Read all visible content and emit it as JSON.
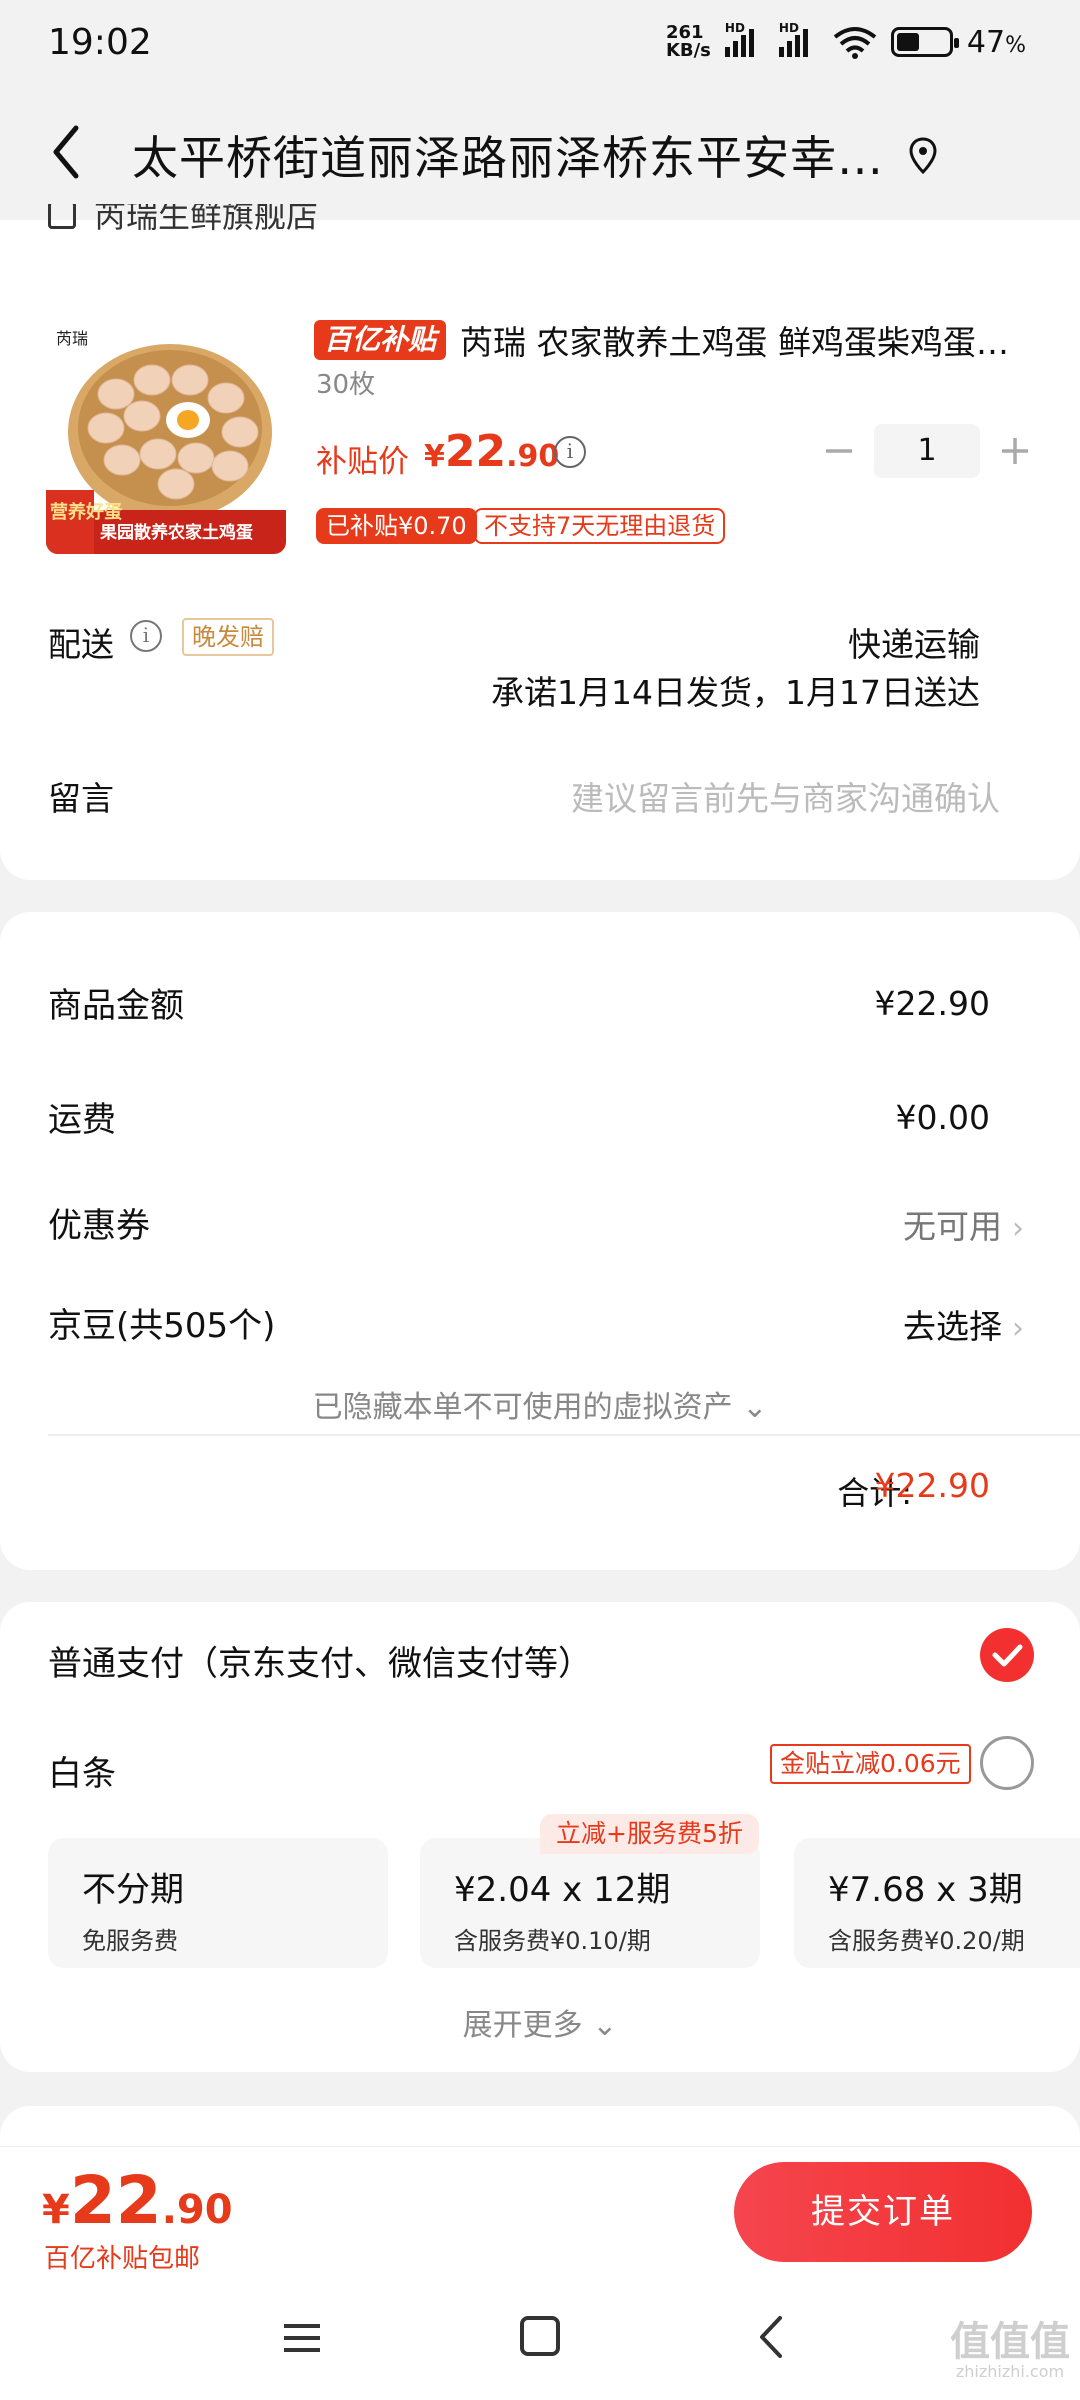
{
  "status_bar": {
    "time": "19:02",
    "net_speed_value": "261",
    "net_speed_unit": "KB/s",
    "hd1": "HD",
    "hd2": "HD",
    "battery": "47",
    "battery_unit": "%"
  },
  "header": {
    "title": "太平桥街道丽泽路丽泽桥东平安幸…"
  },
  "shop": {
    "name": "芮瑞生鲜旗舰店"
  },
  "product": {
    "badge": "百亿补贴",
    "title": "芮瑞 农家散养土鸡蛋 鲜鸡蛋柴鸡蛋…",
    "spec": "30枚",
    "price_label": "补贴价",
    "price_currency": "¥",
    "price_int": "22",
    "price_dec": ".90",
    "quantity": "1",
    "subsidy_tag": "已补贴¥0.70",
    "no_return_tag": "不支持7天无理由退货",
    "image_text_brand": "芮瑞",
    "image_text_left": "营养好蛋",
    "image_text_banner": "果园散养农家土鸡蛋"
  },
  "delivery": {
    "label": "配送",
    "late_tag": "晚发赔",
    "method": "快递运输",
    "promise": "承诺1月14日发货，1月17日送达"
  },
  "note": {
    "label": "留言",
    "placeholder": "建议留言前先与商家沟通确认"
  },
  "summary": {
    "goods_label": "商品金额",
    "goods_value": "¥22.90",
    "shipping_label": "运费",
    "shipping_value": "¥0.00",
    "coupon_label": "优惠券",
    "coupon_value": "无可用",
    "jingdou_label": "京豆(共505个)",
    "jingdou_value": "去选择",
    "hidden_assets": "已隐藏本单不可使用的虚拟资产",
    "total_label": "合计:",
    "total_value": "¥22.90"
  },
  "payment": {
    "normal_label": "普通支付（京东支付、微信支付等）",
    "baitiao_label": "白条",
    "baitiao_coupon": "金贴立减0.06元",
    "promo_bubble": "立减+服务费5折",
    "plans": [
      {
        "title": "不分期",
        "sub": "免服务费"
      },
      {
        "title": "¥2.04 x 12期",
        "sub": "含服务费¥0.10/期"
      },
      {
        "title": "¥7.68 x 3期",
        "sub": "含服务费¥0.20/期"
      }
    ],
    "expand_more": "展开更多"
  },
  "bottom": {
    "currency": "¥",
    "price_int": "22",
    "price_dec": ".90",
    "sub": "百亿补贴包邮",
    "submit": "提交订单"
  },
  "watermark": {
    "main": "值值值",
    "url": "zhizhizhi.com"
  },
  "colors": {
    "accent": "#e63a1b",
    "button": "#f23030",
    "background": "#f2f2f2"
  }
}
